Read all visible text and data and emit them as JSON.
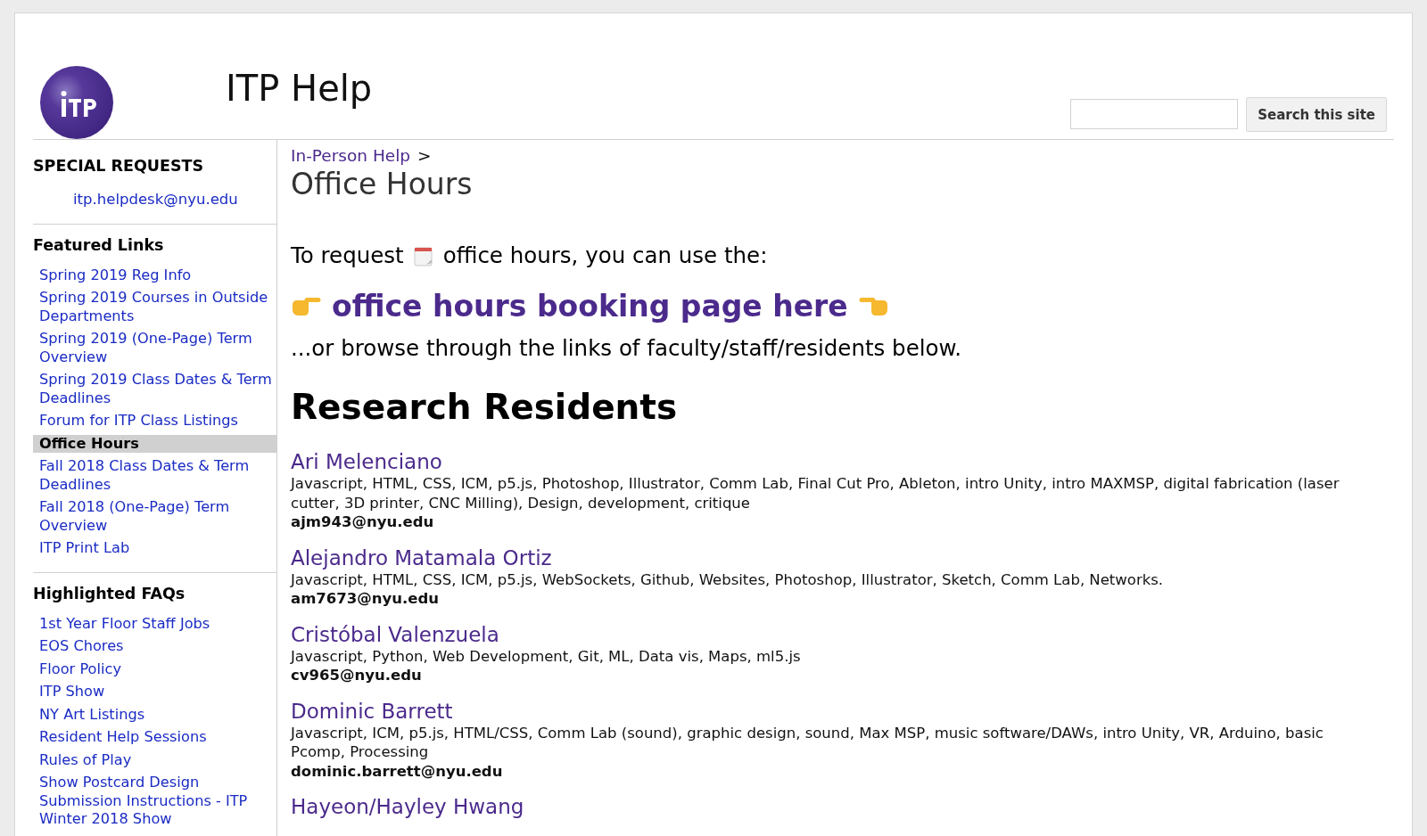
{
  "header": {
    "site_title": "ITP Help",
    "search": {
      "button": "Search this site"
    }
  },
  "sidebar": {
    "special_requests": {
      "title": "SPECIAL REQUESTS",
      "email": "itp.helpdesk@nyu.edu"
    },
    "sections": [
      {
        "title": "Featured Links",
        "items": [
          {
            "label": "Spring 2019 Reg Info",
            "selected": false
          },
          {
            "label": "Spring 2019 Courses in Outside Departments",
            "selected": false
          },
          {
            "label": "Spring 2019 (One-Page) Term Overview",
            "selected": false
          },
          {
            "label": "Spring 2019 Class Dates & Term Deadlines",
            "selected": false
          },
          {
            "label": "Forum for ITP Class Listings",
            "selected": false
          },
          {
            "label": "Office Hours",
            "selected": true
          },
          {
            "label": "Fall 2018 Class Dates & Term Deadlines",
            "selected": false
          },
          {
            "label": "Fall 2018 (One-Page) Term Overview",
            "selected": false
          },
          {
            "label": "ITP Print Lab",
            "selected": false
          }
        ]
      },
      {
        "title": "Highlighted FAQs",
        "items": [
          {
            "label": "1st Year Floor Staff Jobs",
            "selected": false
          },
          {
            "label": "EOS Chores",
            "selected": false
          },
          {
            "label": "Floor Policy",
            "selected": false
          },
          {
            "label": "ITP Show",
            "selected": false
          },
          {
            "label": "NY Art Listings",
            "selected": false
          },
          {
            "label": "Resident Help Sessions",
            "selected": false
          },
          {
            "label": "Rules of Play",
            "selected": false
          },
          {
            "label": "Show Postcard Design Submission Instructions - ITP Winter 2018 Show",
            "selected": false
          }
        ]
      }
    ]
  },
  "content": {
    "breadcrumb": {
      "parent": "In-Person Help",
      "separator": ">"
    },
    "title": "Office Hours",
    "intro_before": "To request",
    "intro_after": "office hours, you can use the:",
    "booking_link": "office hours booking page here",
    "browse_text": "...or browse through the links of faculty/staff/residents below.",
    "section_title": "Research Residents",
    "residents": [
      {
        "name": "Ari Melenciano",
        "skills": "Javascript, HTML, CSS, ICM, p5.js, Photoshop, Illustrator, Comm Lab, Final Cut Pro, Ableton, intro Unity, intro MAXMSP, digital fabrication (laser cutter, 3D printer, CNC Milling), Design, development, critique",
        "email": "ajm943@nyu.edu"
      },
      {
        "name": "Alejandro Matamala Ortiz",
        "skills": "Javascript, HTML, CSS, ICM, p5.js, WebSockets, Github, Websites, Photoshop, Illustrator, Sketch, Comm Lab, Networks.",
        "email": "am7673@nyu.edu"
      },
      {
        "name": "Cristóbal Valenzuela",
        "skills": "Javascript, Python, Web Development, Git, ML, Data vis, Maps, ml5.js",
        "email": "cv965@nyu.edu"
      },
      {
        "name": "Dominic Barrett",
        "skills": "Javascript, ICM, p5.js, HTML/CSS, Comm Lab (sound), graphic design, sound, Max MSP, music software/DAWs, intro Unity, VR, Arduino, basic Pcomp, Processing",
        "email": "dominic.barrett@nyu.edu"
      },
      {
        "name": "Hayeon/Hayley Hwang"
      }
    ]
  }
}
